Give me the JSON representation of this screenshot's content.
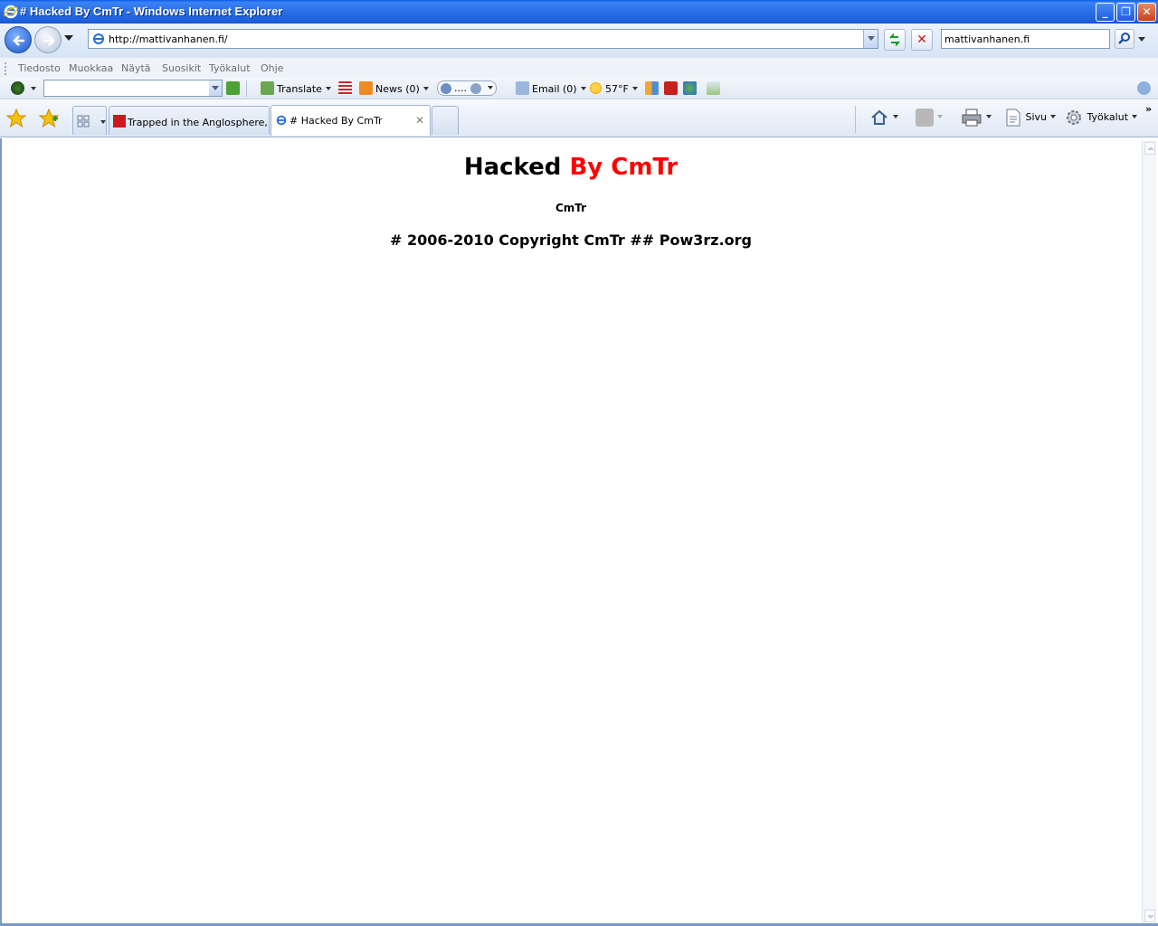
{
  "window": {
    "title": "# Hacked By CmTr - Windows Internet Explorer"
  },
  "address_bar": {
    "url": "http://mattivanhanen.fi/"
  },
  "search": {
    "value": "mattivanhanen.fi"
  },
  "menu": {
    "items": [
      "Tiedosto",
      "Muokkaa",
      "Näytä",
      "Suosikit",
      "Työkalut",
      "Ohje"
    ]
  },
  "toolbar": {
    "translate": "Translate",
    "news": "News (0)",
    "media": "....",
    "email": "Email (0)",
    "weather": "57°F"
  },
  "tabs": [
    {
      "label": "Trapped in the Anglosphere, ...",
      "active": false
    },
    {
      "label": "# Hacked By CmTr",
      "active": true
    }
  ],
  "commands": {
    "page": "Sivu",
    "tools": "Työkalut"
  },
  "page": {
    "heading_black": "Hacked",
    "heading_red": "By CmTr",
    "subheading": "CmTr",
    "copyright": "# 2006-2010 Copyright CmTr ## Pow3rz.org"
  },
  "colors": {
    "titlebar": "#2a6fe6",
    "heading_red": "#ff0000"
  }
}
